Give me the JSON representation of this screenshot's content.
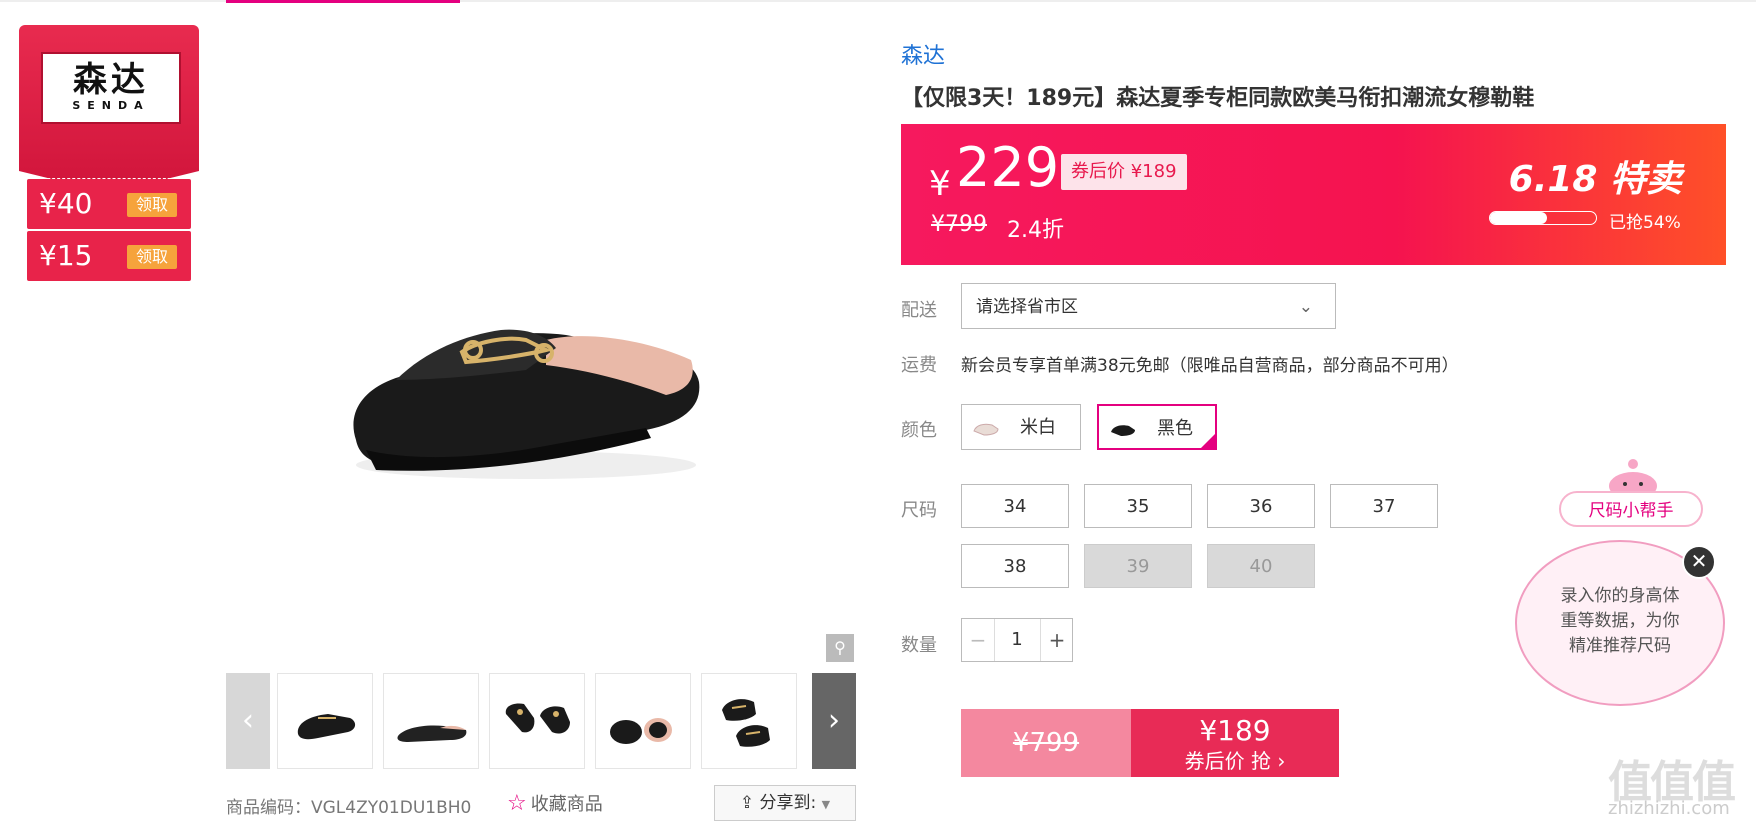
{
  "brand_badge": {
    "logo_cn": "森达",
    "logo_en": "SENDA",
    "coupons": [
      {
        "amount": "¥40",
        "action": "领取"
      },
      {
        "amount": "¥15",
        "action": "领取"
      }
    ]
  },
  "gallery": {
    "prev_icon": "chevron-left-icon",
    "next_icon": "chevron-right-icon",
    "zoom_icon": "magnifier-icon",
    "thumbnail_count": 5
  },
  "meta": {
    "sku": "商品编码：VGL4ZY01DU1BH0",
    "favorite": "收藏商品",
    "share": "分享到:"
  },
  "product": {
    "brand": "森达",
    "title": "【仅限3天！189元】森达夏季专柜同款欧美马衔扣潮流女穆勒鞋"
  },
  "price": {
    "currency": "¥",
    "current": "229",
    "after_coupon": "券后价 ¥189",
    "original": "¥799",
    "discount": "2.4折",
    "promo": "6.18 特卖",
    "sold_text": "已抢54%",
    "sold_fraction": 0.54
  },
  "delivery": {
    "label": "配送",
    "placeholder": "请选择省市区"
  },
  "shipping": {
    "label": "运费",
    "text": "新会员专享首单满38元免邮（限唯品自营商品，部分商品不可用）"
  },
  "colors": {
    "label": "颜色",
    "options": [
      {
        "name": "米白",
        "selected": false
      },
      {
        "name": "黑色",
        "selected": true
      }
    ]
  },
  "sizes": {
    "label": "尺码",
    "options": [
      {
        "value": "34",
        "available": true
      },
      {
        "value": "35",
        "available": true
      },
      {
        "value": "36",
        "available": true
      },
      {
        "value": "37",
        "available": true
      },
      {
        "value": "38",
        "available": true
      },
      {
        "value": "39",
        "available": false
      },
      {
        "value": "40",
        "available": false
      }
    ]
  },
  "quantity": {
    "label": "数量",
    "value": "1",
    "minus": "−",
    "plus": "+"
  },
  "buy": {
    "original": "¥799",
    "price": "¥189",
    "action": "券后价 抢 ›"
  },
  "helper": {
    "tag": "尺码小帮手",
    "text_line1": "录入你的身高体",
    "text_line2": "重等数据，为你",
    "text_line3": "精准推荐尺码",
    "close": "✕"
  },
  "watermark": {
    "title": "值值值",
    "url": "zhizhizhi.com"
  },
  "colors_theme": {
    "accent": "#e4007f",
    "price_bar": "#f6195e",
    "link": "#1f72d5"
  }
}
